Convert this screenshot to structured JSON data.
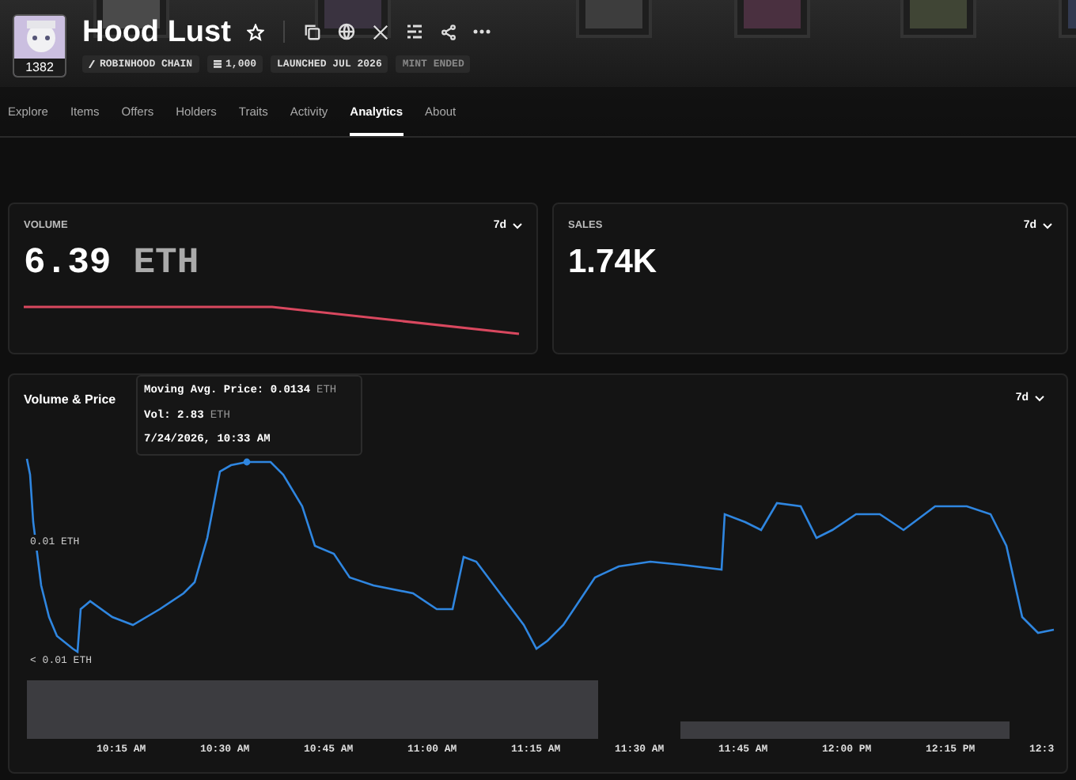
{
  "collection": {
    "avatar_badge": "1382",
    "title": "Hood Lust",
    "starred": false,
    "badges": [
      {
        "kind": "chain",
        "label": "ROBINHOOD CHAIN"
      },
      {
        "kind": "supply",
        "label": "1,000"
      },
      {
        "kind": "date",
        "label": "LAUNCHED JUL 2026"
      },
      {
        "kind": "status",
        "label": "MINT ENDED",
        "muted": true
      }
    ]
  },
  "tabs": [
    {
      "label": "Explore",
      "selected": false
    },
    {
      "label": "Items",
      "selected": false
    },
    {
      "label": "Offers",
      "selected": false
    },
    {
      "label": "Holders",
      "selected": false
    },
    {
      "label": "Traits",
      "selected": false
    },
    {
      "label": "Activity",
      "selected": false
    },
    {
      "label": "Analytics",
      "selected": true
    },
    {
      "label": "About",
      "selected": false
    }
  ],
  "stats": [
    {
      "label": "VOLUME",
      "value": "6.39",
      "unit": "ETH",
      "period": "7d",
      "sparkline": true
    },
    {
      "label": "SALES",
      "value": "1.74K",
      "period": "7d",
      "sparkline": false
    }
  ],
  "volume_price": {
    "title": "Volume & Price",
    "period": "7d",
    "tooltip": {
      "price_label": "Moving Avg. Price:",
      "price": "0.0134",
      "price_unit": "ETH",
      "vol_label": "Vol:",
      "vol": "2.83",
      "vol_unit": "ETH",
      "time": "7/24/2026, 10:33 AM"
    },
    "y_labels": [
      "0.01 ETH",
      "< 0.01 ETH"
    ],
    "x_labels": [
      "10:15 AM",
      "10:30 AM",
      "10:45 AM",
      "11:00 AM",
      "11:15 AM",
      "11:30 AM",
      "11:45 AM",
      "12:00 PM",
      "12:15 PM",
      "12:3"
    ]
  }
}
